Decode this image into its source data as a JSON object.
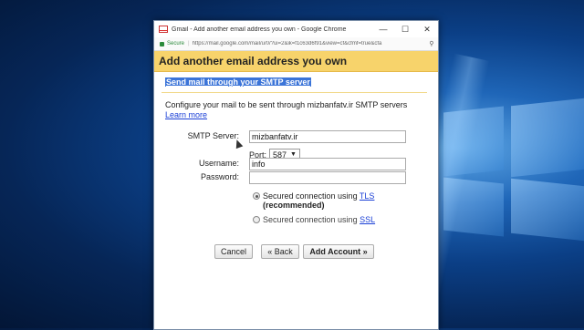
{
  "window": {
    "title": "Gmail - Add another email address you own - Google Chrome",
    "minimize": "—",
    "maximize": "☐",
    "close": "✕"
  },
  "addressbar": {
    "secure_label": "Secure",
    "url": "https://mail.google.com/mail/u/0/?ui=2&ik=f1c63d6f91&view=cf&cfmf=true&cfa"
  },
  "page": {
    "header": "Add another email address you own",
    "section_title": "Send mail through your SMTP server",
    "description": "Configure your mail to be sent through mizbanfatv.ir SMTP servers",
    "learn_more": "Learn more"
  },
  "form": {
    "smtp_label": "SMTP Server:",
    "smtp_value": "mizbanfatv.ir",
    "port_label": "Port:",
    "port_value": "587",
    "username_label": "Username:",
    "username_value": "info",
    "password_label": "Password:",
    "password_value": "",
    "tls_prefix": "Secured connection using",
    "tls_link": "TLS",
    "tls_note": "(recommended)",
    "ssl_prefix": "Secured connection using",
    "ssl_link": "SSL"
  },
  "buttons": {
    "cancel": "Cancel",
    "back": "« Back",
    "add": "Add Account »"
  },
  "colors": {
    "header_bg": "#f7d36b",
    "section_highlight": "#3b74d8",
    "link": "#1a3fd6",
    "secure": "#2a8a3a"
  }
}
